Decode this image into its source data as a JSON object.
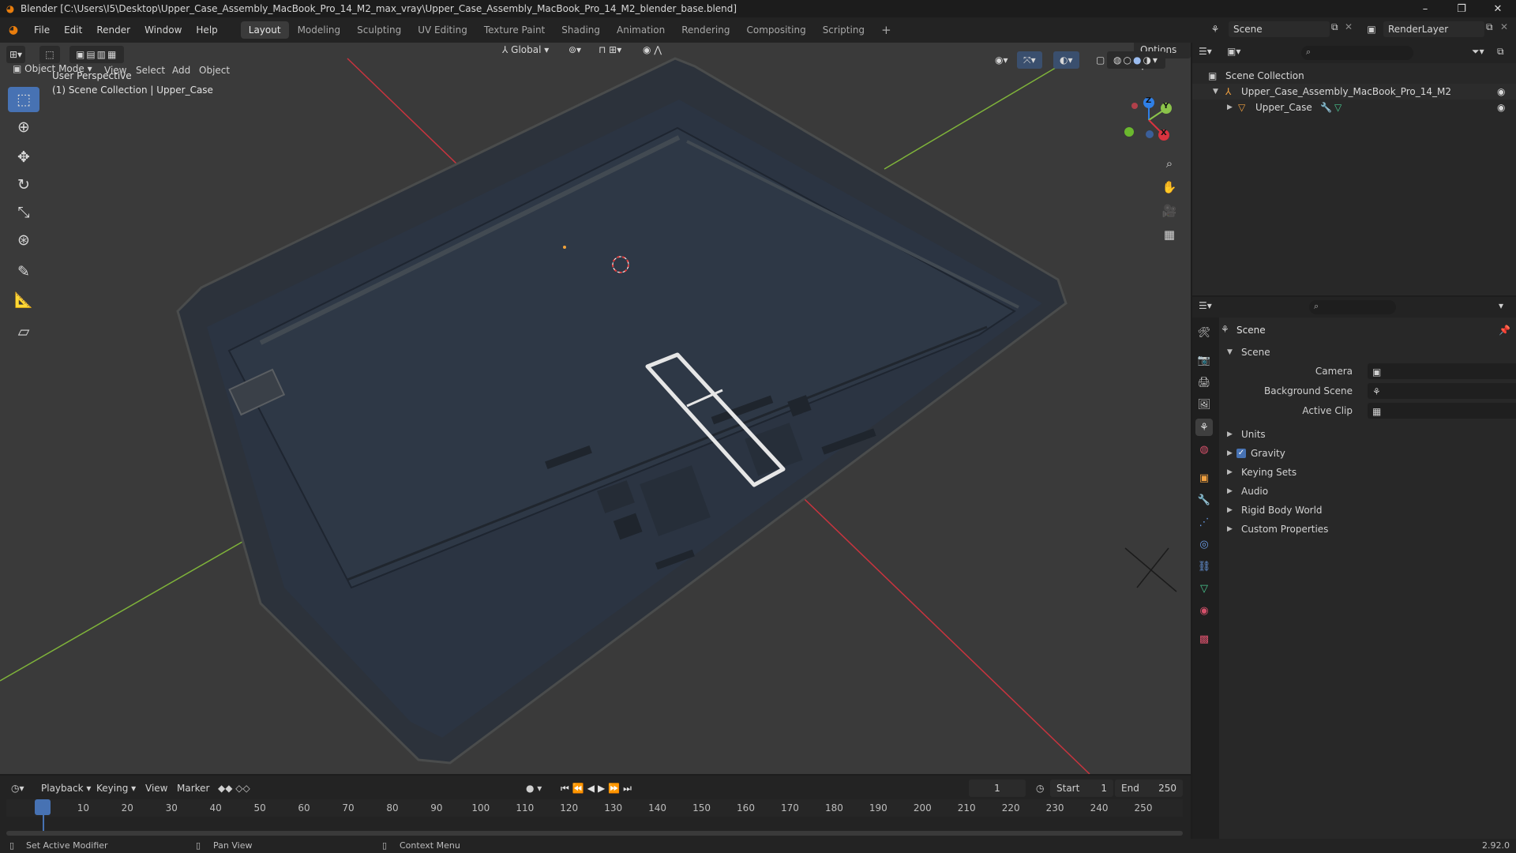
{
  "titlebar": {
    "title": "Blender [C:\\Users\\I5\\Desktop\\Upper_Case_Assembly_MacBook_Pro_14_M2_max_vray\\Upper_Case_Assembly_MacBook_Pro_14_M2_blender_base.blend]",
    "minimize": "–",
    "maximize": "❐",
    "close": "✕"
  },
  "menubar": {
    "menus": [
      "File",
      "Edit",
      "Render",
      "Window",
      "Help"
    ],
    "workspaces": [
      "Layout",
      "Modeling",
      "Sculpting",
      "UV Editing",
      "Texture Paint",
      "Shading",
      "Animation",
      "Rendering",
      "Compositing",
      "Scripting"
    ],
    "active_workspace": "Layout",
    "add_tab": "+",
    "scene_label": "Scene",
    "render_layer_label": "RenderLayer"
  },
  "viewport": {
    "mode": "Object Mode",
    "menus": [
      "View",
      "Select",
      "Add",
      "Object"
    ],
    "orientation": "Global",
    "options": "Options",
    "overlay_line1": "User Perspective",
    "overlay_line2": "(1) Scene Collection | Upper_Case",
    "gizmo": {
      "x": "X",
      "y": "Y",
      "z": "Z"
    },
    "colors": {
      "x_axis": "#d8333f",
      "y_axis": "#8bc34a",
      "z_axis": "#2f7fe6",
      "active_tool": "#4772b3",
      "selection": "#e6e6e6",
      "case": "#2b3442"
    }
  },
  "outliner": {
    "root": "Scene Collection",
    "items": [
      {
        "label": "Upper_Case_Assembly_MacBook_Pro_14_M2"
      },
      {
        "label": "Upper_Case"
      }
    ]
  },
  "properties": {
    "context": "Scene",
    "panel": "Scene",
    "fields": [
      {
        "label": "Camera"
      },
      {
        "label": "Background Scene"
      },
      {
        "label": "Active Clip"
      }
    ],
    "sections": [
      "Units",
      "Gravity",
      "Keying Sets",
      "Audio",
      "Rigid Body World",
      "Custom Properties"
    ],
    "gravity_checked": true
  },
  "timeline": {
    "menus": [
      "Playback",
      "Keying",
      "View",
      "Marker"
    ],
    "current_frame": "1",
    "start_label": "Start",
    "start_value": "1",
    "end_label": "End",
    "end_value": "250",
    "ticks": [
      "1",
      "10",
      "20",
      "30",
      "40",
      "50",
      "60",
      "70",
      "80",
      "90",
      "100",
      "110",
      "120",
      "130",
      "140",
      "150",
      "160",
      "170",
      "180",
      "190",
      "200",
      "210",
      "220",
      "230",
      "240",
      "250"
    ]
  },
  "statusbar": {
    "hint1": "Set Active Modifier",
    "hint2": "Pan View",
    "hint3": "Context Menu",
    "version": "2.92.0"
  }
}
